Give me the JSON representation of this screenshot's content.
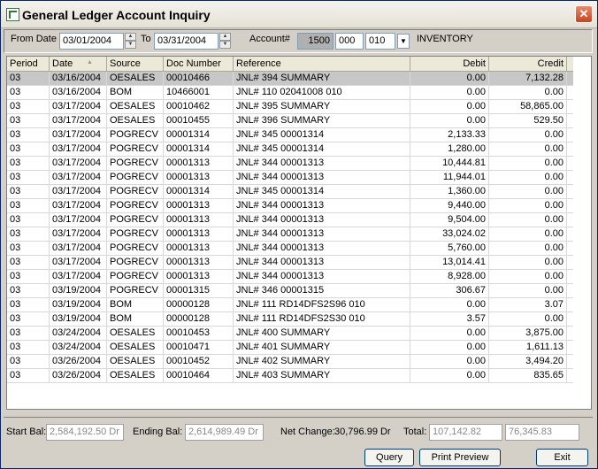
{
  "window": {
    "title": "General Ledger Account Inquiry"
  },
  "filters": {
    "from_date_label": "From Date",
    "from_date": "03/01/2004",
    "to_label": "To",
    "to_date": "03/31/2004",
    "account_label": "Account#",
    "account_part1": "1500",
    "account_part2": "000",
    "account_part3": "010",
    "account_name": "INVENTORY"
  },
  "table": {
    "columns": [
      "Period",
      "Date",
      "Source",
      "Doc Number",
      "Reference",
      "Debit",
      "Credit"
    ],
    "rows": [
      [
        "03",
        "03/16/2004",
        "OESALES",
        "00010466",
        "JNL# 394 SUMMARY",
        "0.00",
        "7,132.28"
      ],
      [
        "03",
        "03/16/2004",
        "BOM",
        "10466001",
        "JNL# 110 02041008 010",
        "0.00",
        "0.00"
      ],
      [
        "03",
        "03/17/2004",
        "OESALES",
        "00010462",
        "JNL# 395 SUMMARY",
        "0.00",
        "58,865.00"
      ],
      [
        "03",
        "03/17/2004",
        "OESALES",
        "00010455",
        "JNL# 396 SUMMARY",
        "0.00",
        "529.50"
      ],
      [
        "03",
        "03/17/2004",
        "POGRECV",
        "00001314",
        "JNL# 345 00001314",
        "2,133.33",
        "0.00"
      ],
      [
        "03",
        "03/17/2004",
        "POGRECV",
        "00001314",
        "JNL# 345 00001314",
        "1,280.00",
        "0.00"
      ],
      [
        "03",
        "03/17/2004",
        "POGRECV",
        "00001313",
        "JNL# 344 00001313",
        "10,444.81",
        "0.00"
      ],
      [
        "03",
        "03/17/2004",
        "POGRECV",
        "00001313",
        "JNL# 344 00001313",
        "11,944.01",
        "0.00"
      ],
      [
        "03",
        "03/17/2004",
        "POGRECV",
        "00001314",
        "JNL# 345 00001314",
        "1,360.00",
        "0.00"
      ],
      [
        "03",
        "03/17/2004",
        "POGRECV",
        "00001313",
        "JNL# 344 00001313",
        "9,440.00",
        "0.00"
      ],
      [
        "03",
        "03/17/2004",
        "POGRECV",
        "00001313",
        "JNL# 344 00001313",
        "9,504.00",
        "0.00"
      ],
      [
        "03",
        "03/17/2004",
        "POGRECV",
        "00001313",
        "JNL# 344 00001313",
        "33,024.02",
        "0.00"
      ],
      [
        "03",
        "03/17/2004",
        "POGRECV",
        "00001313",
        "JNL# 344 00001313",
        "5,760.00",
        "0.00"
      ],
      [
        "03",
        "03/17/2004",
        "POGRECV",
        "00001313",
        "JNL# 344 00001313",
        "13,014.41",
        "0.00"
      ],
      [
        "03",
        "03/17/2004",
        "POGRECV",
        "00001313",
        "JNL# 344 00001313",
        "8,928.00",
        "0.00"
      ],
      [
        "03",
        "03/19/2004",
        "POGRECV",
        "00001315",
        "JNL# 346 00001315",
        "306.67",
        "0.00"
      ],
      [
        "03",
        "03/19/2004",
        "BOM",
        "00000128",
        "JNL# 111 RD14DFS2S96 010",
        "0.00",
        "3.07"
      ],
      [
        "03",
        "03/19/2004",
        "BOM",
        "00000128",
        "JNL# 111 RD14DFS2S30 010",
        "3.57",
        "0.00"
      ],
      [
        "03",
        "03/24/2004",
        "OESALES",
        "00010453",
        "JNL# 400 SUMMARY",
        "0.00",
        "3,875.00"
      ],
      [
        "03",
        "03/24/2004",
        "OESALES",
        "00010471",
        "JNL# 401 SUMMARY",
        "0.00",
        "1,611.13"
      ],
      [
        "03",
        "03/26/2004",
        "OESALES",
        "00010452",
        "JNL# 402 SUMMARY",
        "0.00",
        "3,494.20"
      ],
      [
        "03",
        "03/26/2004",
        "OESALES",
        "00010464",
        "JNL# 403 SUMMARY",
        "0.00",
        "835.65"
      ]
    ]
  },
  "summary": {
    "start_bal_label": "Start Bal:",
    "start_bal": "2,584,192.50 Dr",
    "ending_bal_label": "Ending Bal:",
    "ending_bal": "2,614,989.49 Dr",
    "net_change_label": "Net Change:",
    "net_change": "30,796.99 Dr",
    "total_label": "Total:",
    "total_debit": "107,142.82",
    "total_credit": "76,345.83"
  },
  "buttons": {
    "query": "Query",
    "print_preview": "Print Preview",
    "exit": "Exit"
  }
}
